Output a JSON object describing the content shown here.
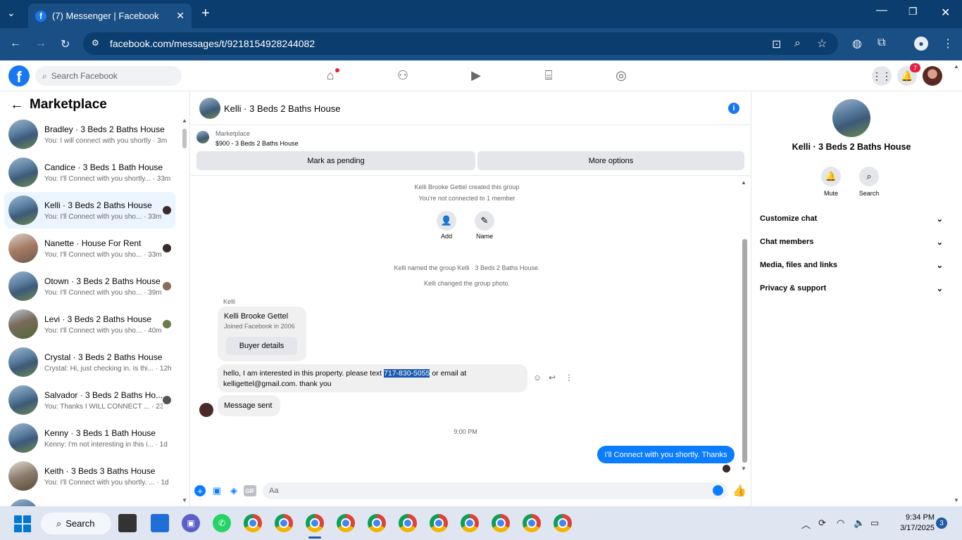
{
  "browser": {
    "tab_title": "(7) Messenger | Facebook",
    "url": "facebook.com/messages/t/9218154928244082"
  },
  "header": {
    "search_placeholder": "Search Facebook",
    "notification_count": "7"
  },
  "sidebar": {
    "title": "Marketplace",
    "conversations": [
      {
        "name": "Bradley · 3 Beds 2 Baths House",
        "preview": "You: I will connect with you shortly · 3m"
      },
      {
        "name": "Candice · 3 Beds 1 Bath House",
        "preview": "You: I'll Connect with you shortly... · 33m"
      },
      {
        "name": "Kelli · 3 Beds 2 Baths House",
        "preview": "You: I'll Connect with you sho... · 33m"
      },
      {
        "name": "Nanette · House For Rent",
        "preview": "You: I'll Connect with you sho... · 33m"
      },
      {
        "name": "Otown · 3 Beds 2 Baths House",
        "preview": "You: I'll Connect with you sho... · 39m"
      },
      {
        "name": "Levi · 3 Beds 2 Baths House",
        "preview": "You: I'll Connect with you sho... · 40m"
      },
      {
        "name": "Crystal · 3 Beds 2 Baths House",
        "preview": "Crystal: Hi, just checking in. Is thi... · 12h"
      },
      {
        "name": "Salvador · 3 Beds 2 Baths Ho...",
        "preview": "You: Thanks I WILL CONNECT ... · 23h"
      },
      {
        "name": "Kenny · 3 Beds 1 Bath House",
        "preview": "Kenny: I'm not interesting in this i... · 1d"
      },
      {
        "name": "Keith · 3 Beds 3 Baths House",
        "preview": "You: I'll Connect with you shortly. ... · 1d"
      }
    ]
  },
  "chat": {
    "title": "Kelli · 3 Beds 2 Baths House",
    "marketplace_label": "Marketplace",
    "listing": "$900 - 3 Beds 2 Baths House",
    "mark_pending": "Mark as pending",
    "more_options": "More options",
    "sys_created": "Kelli Brooke Gettel created this group",
    "sys_not_connected": "You're not connected to 1 member",
    "add_label": "Add",
    "name_label": "Name",
    "sys_named": "Kelli named the group Kelli · 3 Beds 2 Baths House.",
    "sys_photo": "Kelli changed the group photo.",
    "sender": "Kelli",
    "buyer_name": "Kelli Brooke Gettel",
    "buyer_joined": "Joined Facebook in 2006",
    "buyer_details": "Buyer details",
    "msg1_a": "hello, I am interested in this property. please text ",
    "msg1_phone": "717-830-5055",
    "msg1_b": " or email at kelligettel@gmail.com. thank you",
    "msg2": "Message sent",
    "time": "9:00 PM",
    "my_msg": "I'll Connect with you shortly. Thanks",
    "composer_placeholder": "Aa",
    "gif": "GIF"
  },
  "info_panel": {
    "name": "Kelli · 3 Beds 2 Baths House",
    "mute": "Mute",
    "search": "Search",
    "sections": [
      "Customize chat",
      "Chat members",
      "Media, files and links",
      "Privacy & support"
    ]
  },
  "taskbar": {
    "search": "Search",
    "time": "9:34 PM",
    "date": "3/17/2025",
    "notifications": "3"
  }
}
